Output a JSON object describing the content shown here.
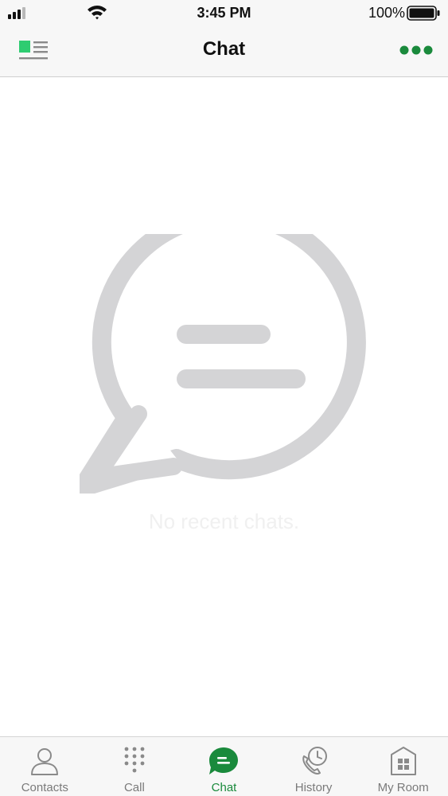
{
  "status_bar": {
    "time": "3:45 PM",
    "battery_percent": "100%",
    "icons": [
      "cellular-signal-icon",
      "wifi-icon",
      "battery-icon"
    ]
  },
  "nav": {
    "title": "Chat",
    "left_icon": "sidebar-menu-icon",
    "right_icon": "more-options-icon"
  },
  "empty_state": {
    "icon": "chat-bubble-icon",
    "message": "No recent chats."
  },
  "tabs": [
    {
      "label": "Contacts",
      "icon": "contacts-icon",
      "active": false
    },
    {
      "label": "Call",
      "icon": "dialpad-icon",
      "active": false
    },
    {
      "label": "Chat",
      "icon": "chat-icon",
      "active": true
    },
    {
      "label": "History",
      "icon": "history-icon",
      "active": false
    },
    {
      "label": "My Room",
      "icon": "my-room-icon",
      "active": false
    }
  ],
  "colors": {
    "accent": "#1a8a3c",
    "accent_light": "#2ecc71",
    "inactive": "#7a7a7a",
    "illustration": "#d4d4d6",
    "bar_background": "#f7f7f7"
  }
}
